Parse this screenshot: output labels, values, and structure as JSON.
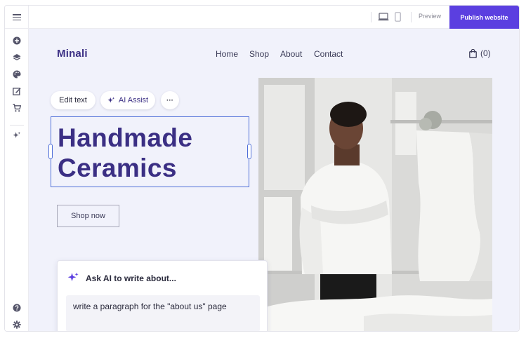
{
  "editor": {
    "preview_label": "Preview",
    "publish_label": "Publish website"
  },
  "site": {
    "logo": "Minali",
    "nav": [
      "Home",
      "Shop",
      "About",
      "Contact"
    ],
    "cart_count": "(0)",
    "hero_title_line1": "Handmade",
    "hero_title_line2": "Ceramics",
    "shop_button": "Shop now"
  },
  "toolbar": {
    "edit_text": "Edit text",
    "ai_assist": "AI Assist",
    "more": "···"
  },
  "ai_panel": {
    "title": "Ask AI to write about...",
    "input_value": "write a paragraph for the \"about us\" page"
  },
  "colors": {
    "brand": "#3b2f84",
    "accent": "#5b3fe0",
    "selection": "#4f6fd8",
    "canvas": "#f1f2fb"
  },
  "icons": {
    "sidebar": [
      "add-icon",
      "layers-icon",
      "palette-icon",
      "edit-page-icon",
      "cart-icon",
      "sparkle-icon",
      "help-icon",
      "settings-icon"
    ],
    "devices": [
      "desktop-icon",
      "mobile-icon"
    ]
  }
}
